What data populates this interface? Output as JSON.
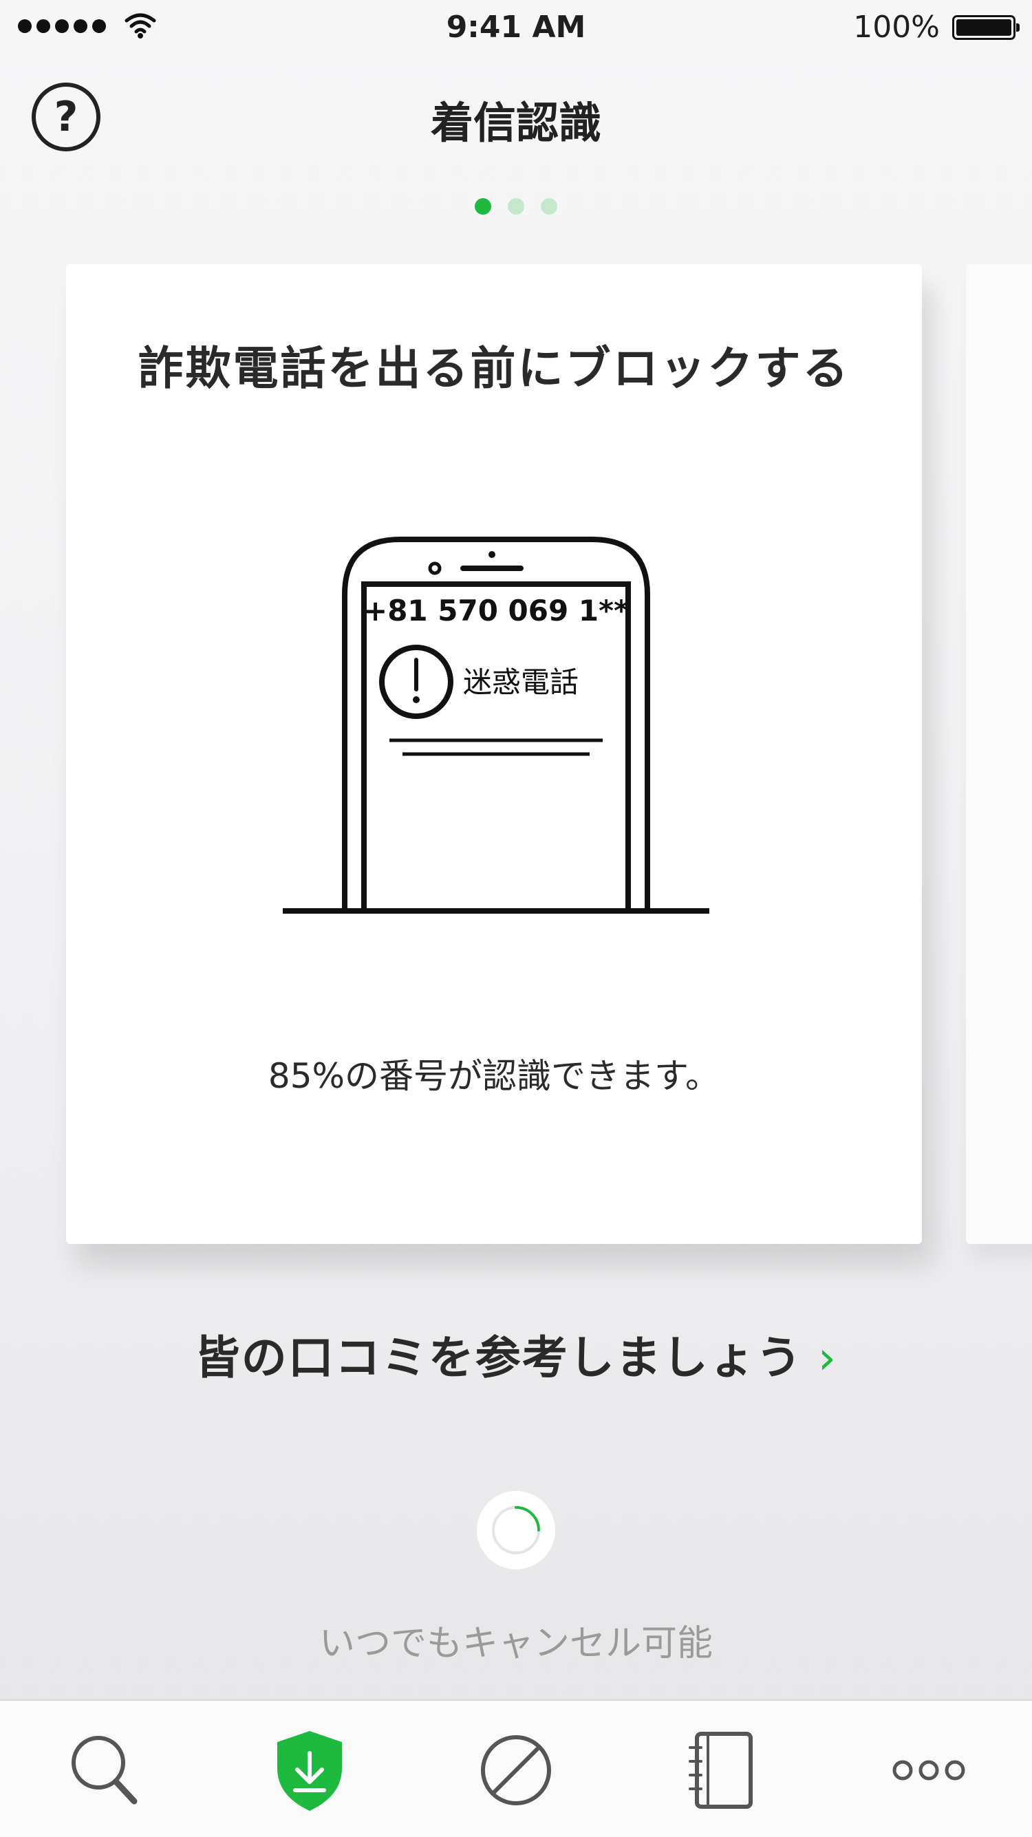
{
  "status_bar": {
    "time": "9:41 AM",
    "battery": "100%"
  },
  "nav": {
    "help_label": "?",
    "title": "着信認識"
  },
  "pager": {
    "count": 3,
    "active_index": 0
  },
  "card": {
    "title": "詐欺電話を出る前にブロックする",
    "phone_number": "+81 570 069 1**",
    "warning_label": "迷惑電話",
    "caption": "85%の番号が認識できます。"
  },
  "reviews_link": {
    "label": "皆の口コミを参考しましょう",
    "chevron": "›"
  },
  "cancel_note": "いつでもキャンセル可能",
  "tabs": [
    {
      "name": "search",
      "icon": "search-icon"
    },
    {
      "name": "protection",
      "icon": "shield-download-icon"
    },
    {
      "name": "block",
      "icon": "block-icon"
    },
    {
      "name": "contacts",
      "icon": "notebook-icon"
    },
    {
      "name": "more",
      "icon": "more-icon"
    }
  ],
  "colors": {
    "accent": "#1dba3f",
    "accent_light": "#c5e8cd",
    "text": "#222222"
  }
}
